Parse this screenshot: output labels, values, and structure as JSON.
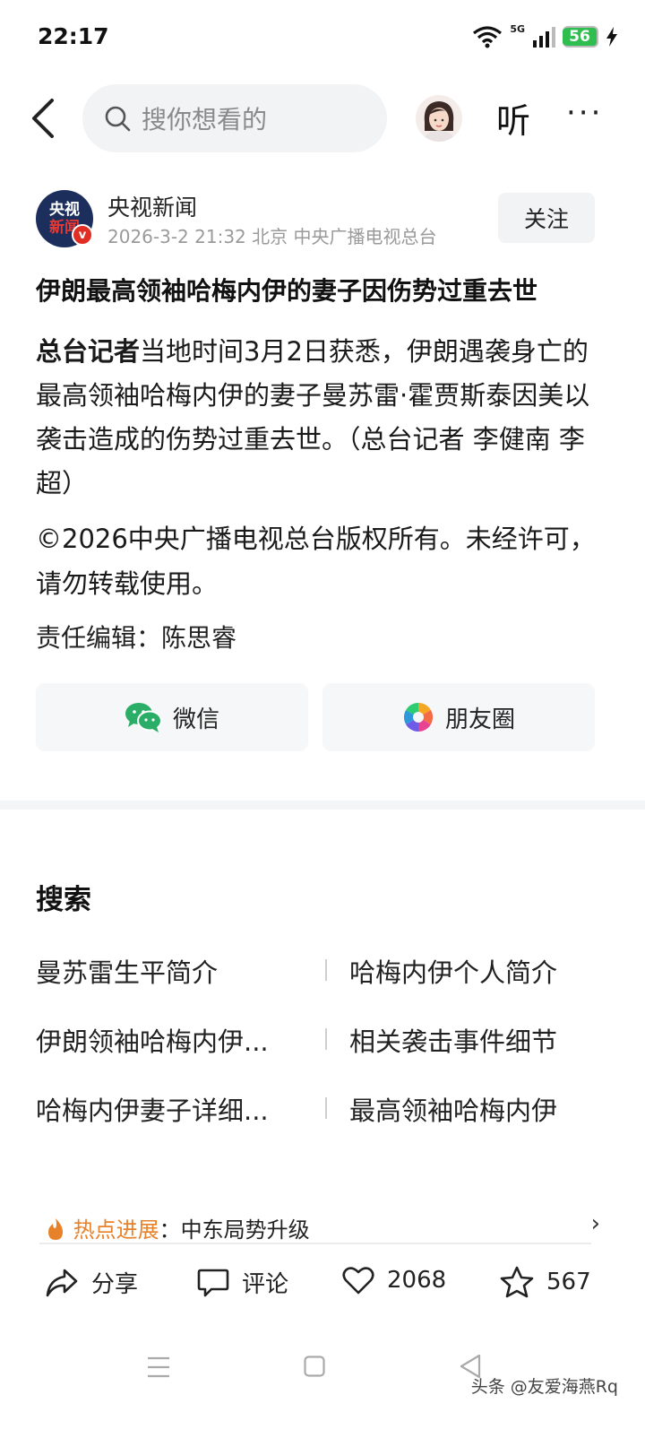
{
  "status_bar": {
    "time": "22:17",
    "network": "5G",
    "battery": "56"
  },
  "header": {
    "search_placeholder": "搜你想看的",
    "listen_label": "听",
    "more_label": "···"
  },
  "author": {
    "logo_line1": "央视",
    "logo_line2": "新闻",
    "verified_badge": "v",
    "name": "央视新闻",
    "meta": "2026-3-2  21:32  北京  中央广播电视总台",
    "follow_label": "关注"
  },
  "article": {
    "title": "伊朗最高领袖哈梅内伊的妻子因伤势过重去世",
    "lead": "总台记者",
    "body": "当地时间3月2日获悉，伊朗遇袭身亡的最高领袖哈梅内伊的妻子曼苏雷·霍贾斯泰因美以袭击造成的伤势过重去世。（总台记者 李健南 李超）",
    "copyright": "©2026中央广播电视总台版权所有。未经许可，请勿转载使用。",
    "editor": "责任编辑：陈思睿"
  },
  "share": {
    "wechat_label": "微信",
    "moments_label": "朋友圈"
  },
  "search_section": {
    "title": "搜索",
    "suggestions": [
      "曼苏雷生平简介",
      "哈梅内伊个人简介",
      "伊朗领袖哈梅内伊...",
      "相关袭击事件细节",
      "哈梅内伊妻子详细...",
      "最高领袖哈梅内伊"
    ]
  },
  "hot_bar": {
    "label": "热点进展",
    "text": "：中东局势升级"
  },
  "bottom_actions": {
    "share_label": "分享",
    "comment_label": "评论",
    "like_count": "2068",
    "favorite_count": "567"
  },
  "watermark": "头条 @友爱海燕Rq",
  "colors": {
    "accent_orange": "#e8822a",
    "wechat_green": "#2aae67",
    "verified_red": "#e02e24",
    "logo_navy": "#1c2f5c"
  }
}
